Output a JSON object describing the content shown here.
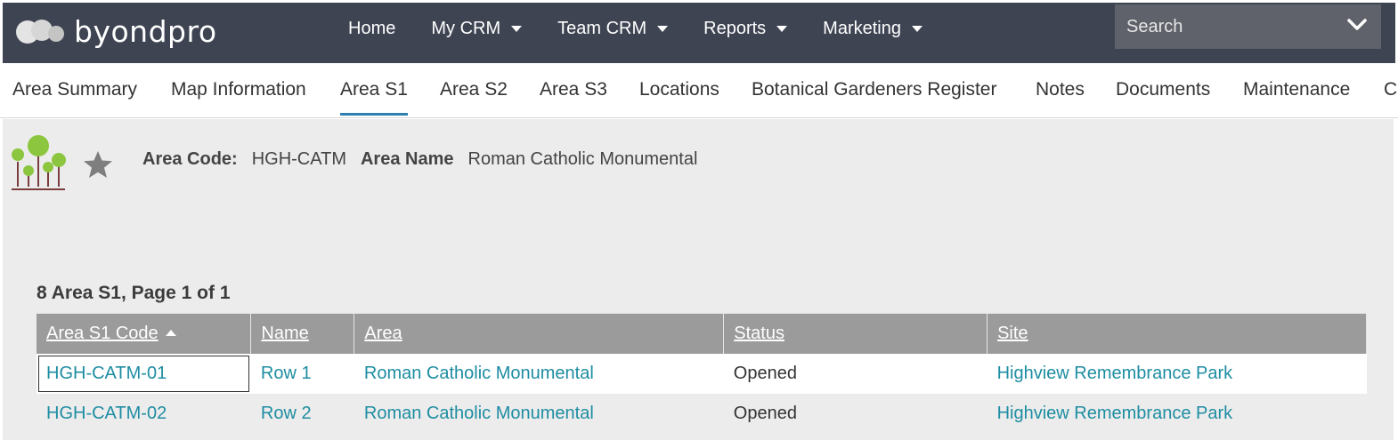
{
  "brand": {
    "name": "byondpro"
  },
  "nav": {
    "items": [
      {
        "label": "Home",
        "dropdown": false
      },
      {
        "label": "My CRM",
        "dropdown": true
      },
      {
        "label": "Team CRM",
        "dropdown": true
      },
      {
        "label": "Reports",
        "dropdown": true
      },
      {
        "label": "Marketing",
        "dropdown": true
      }
    ]
  },
  "search": {
    "placeholder": "Search",
    "value": ""
  },
  "tabs": [
    {
      "label": "Area Summary",
      "active": false
    },
    {
      "label": "Map Information",
      "active": false
    },
    {
      "label": "Area S1",
      "active": true
    },
    {
      "label": "Area S2",
      "active": false
    },
    {
      "label": "Area S3",
      "active": false
    },
    {
      "label": "Locations",
      "active": false
    },
    {
      "label": "Botanical Gardeners Register",
      "active": false
    },
    {
      "label": "Notes",
      "active": false
    },
    {
      "label": "Documents",
      "active": false
    },
    {
      "label": "Maintenance",
      "active": false
    },
    {
      "label": "C",
      "active": false
    }
  ],
  "record": {
    "code_label": "Area Code:",
    "code_value": "HGH-CATM",
    "name_label": "Area Name",
    "name_value": "Roman Catholic Monumental"
  },
  "list": {
    "summary": "8 Area S1, Page 1 of 1",
    "columns": [
      "Area S1 Code",
      "Name",
      "Area",
      "Status",
      "Site"
    ],
    "rows": [
      {
        "code": "HGH-CATM-01",
        "name": "Row 1",
        "area": "Roman Catholic Monumental",
        "status": "Opened",
        "site": "Highview Remembrance Park"
      },
      {
        "code": "HGH-CATM-02",
        "name": "Row 2",
        "area": "Roman Catholic Monumental",
        "status": "Opened",
        "site": "Highview Remembrance Park"
      }
    ]
  },
  "colors": {
    "topbar": "#3e4452",
    "link": "#1e8da2",
    "active_tab_underline": "#2e7fb0",
    "header_bg": "#9b9b9b"
  }
}
